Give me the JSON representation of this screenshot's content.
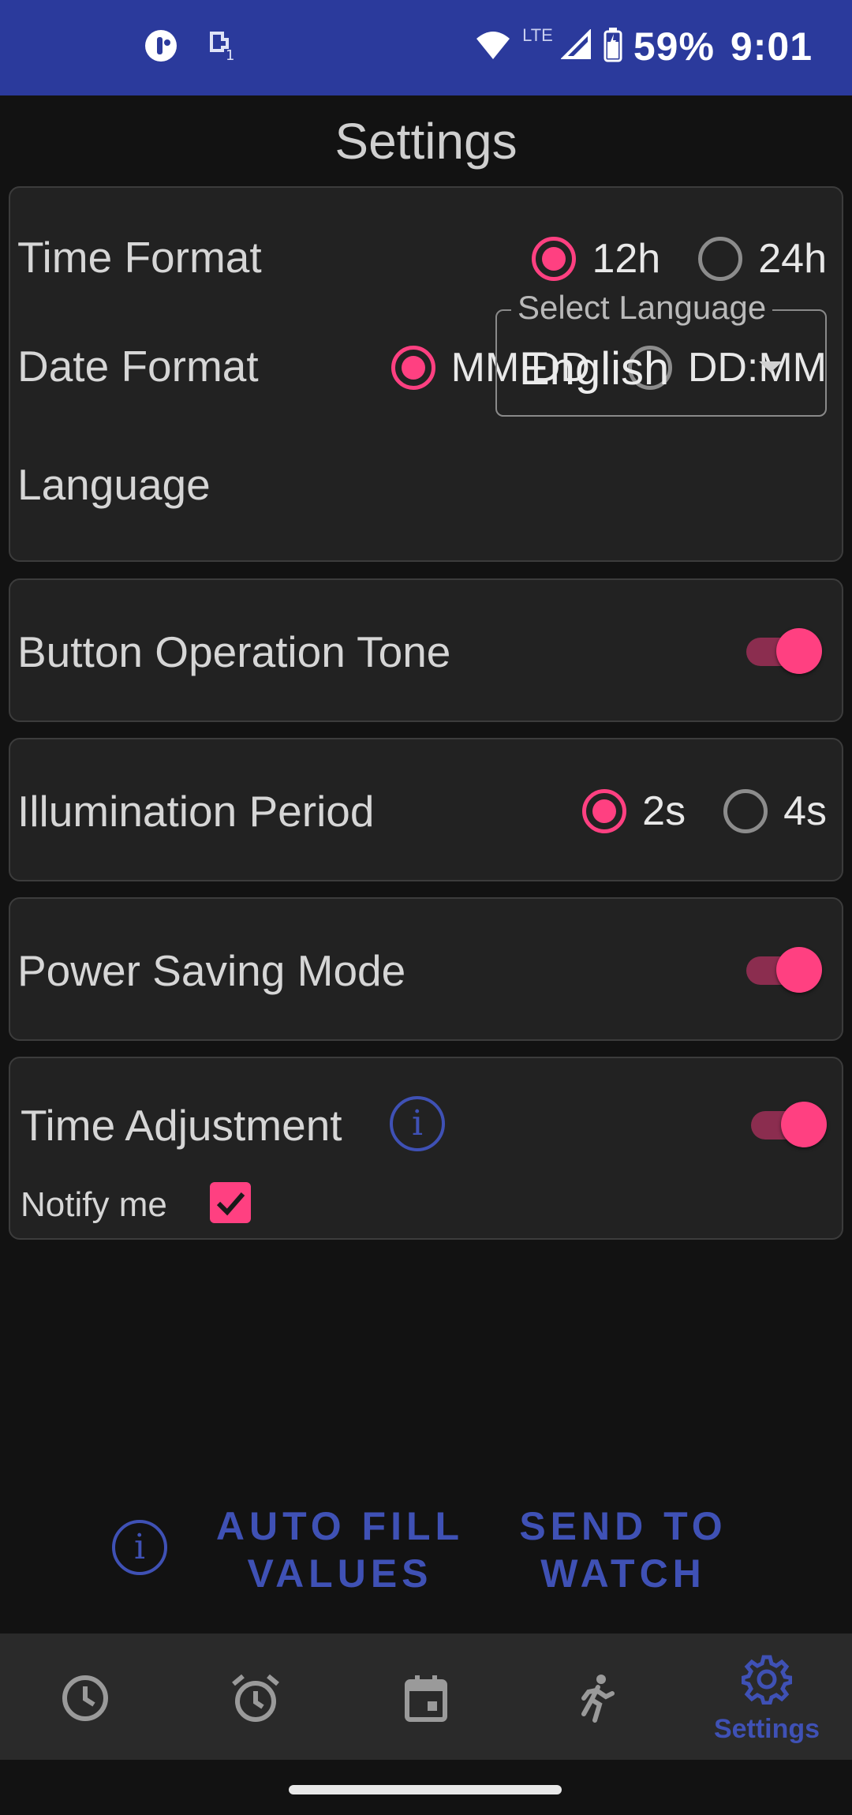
{
  "status_bar": {
    "battery": "59%",
    "time": "9:01",
    "network": "LTE"
  },
  "page": {
    "title": "Settings"
  },
  "time_format": {
    "label": "Time Format",
    "options": [
      "12h",
      "24h"
    ],
    "selected": "12h"
  },
  "date_format": {
    "label": "Date Format",
    "options": [
      "MM:DD",
      "DD:MM"
    ],
    "selected": "MM:DD"
  },
  "language": {
    "label": "Language",
    "select_label": "Select Language",
    "value": "English"
  },
  "button_tone": {
    "label": "Button Operation Tone",
    "enabled": true
  },
  "illumination": {
    "label": "Illumination Period",
    "options": [
      "2s",
      "4s"
    ],
    "selected": "2s"
  },
  "power_saving": {
    "label": "Power Saving Mode",
    "enabled": true
  },
  "time_adjustment": {
    "label": "Time Adjustment",
    "enabled": true,
    "notify_label": "Notify me",
    "notify_checked": true
  },
  "actions": {
    "auto_fill_line1": "AUTO FILL",
    "auto_fill_line2": "VALUES",
    "send_line1": "SEND TO",
    "send_line2": "WATCH"
  },
  "bottom_nav": {
    "items": [
      "time",
      "alarms",
      "events",
      "activity",
      "Settings"
    ],
    "active_label": "Settings"
  },
  "colors": {
    "accent": "#ff4081",
    "primary": "#3f51b5",
    "status_bar": "#2b3a9c",
    "background": "#121212",
    "card": "#222222"
  }
}
